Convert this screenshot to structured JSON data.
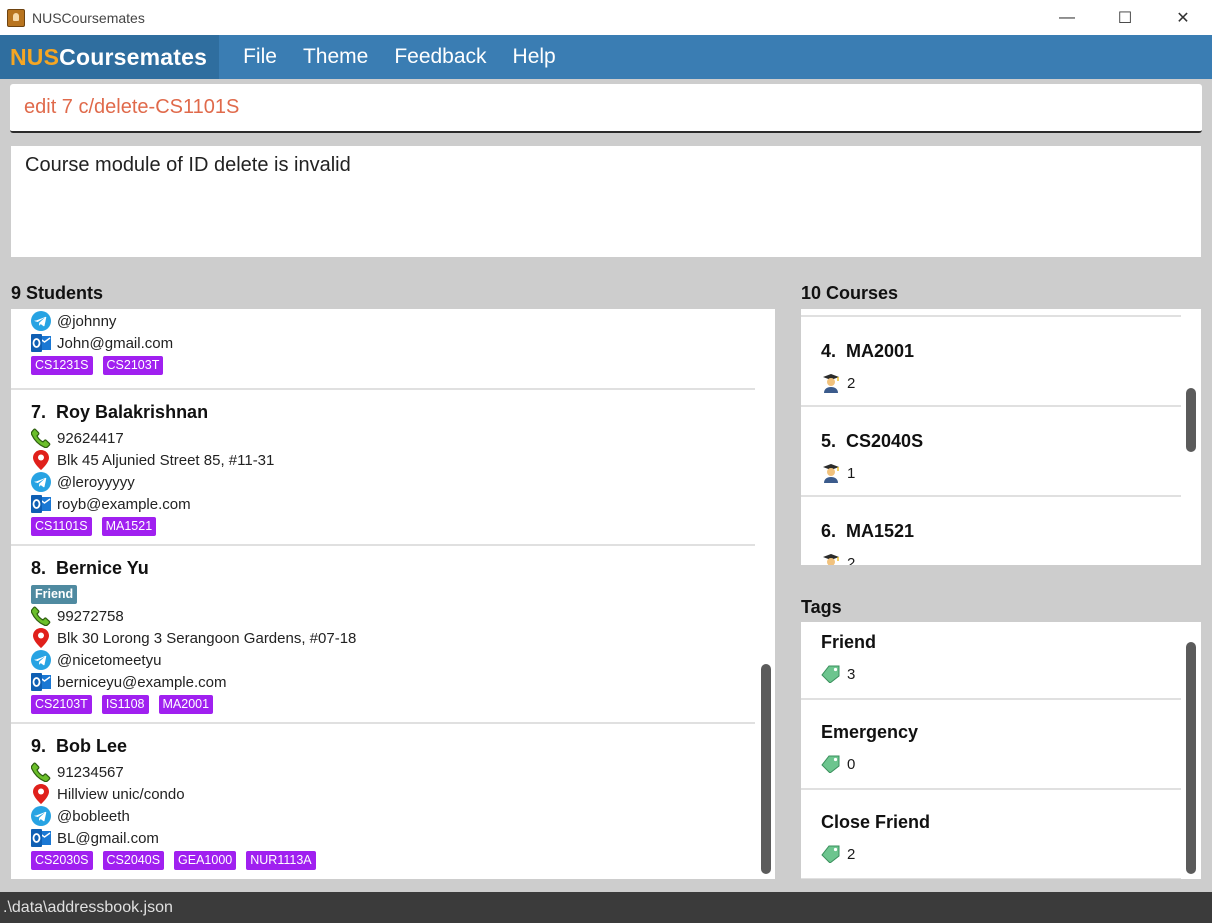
{
  "window": {
    "title": "NUSCoursemates",
    "minimize_glyph": "—",
    "maximize_glyph": "☐",
    "close_glyph": "✕"
  },
  "menubar": {
    "brand_prefix": "NUS",
    "brand_suffix": "Coursemates",
    "items": [
      "File",
      "Theme",
      "Feedback",
      "Help"
    ]
  },
  "command": {
    "value": "edit 7 c/delete-CS1101S"
  },
  "result": {
    "text": "Course module of ID delete is invalid"
  },
  "students": {
    "header": "9 Students",
    "cards": [
      {
        "index": "",
        "name": "",
        "tags": [],
        "phone": "",
        "address": "",
        "telegram": "@johnny",
        "email": "John@gmail.com",
        "courses": [
          "CS1231S",
          "CS2103T"
        ]
      },
      {
        "index": "7.",
        "name": "Roy Balakrishnan",
        "tags": [],
        "phone": "92624417",
        "address": "Blk 45 Aljunied Street 85, #11-31",
        "telegram": "@leroyyyyy",
        "email": "royb@example.com",
        "courses": [
          "CS1101S",
          "MA1521"
        ]
      },
      {
        "index": "8.",
        "name": "Bernice Yu",
        "tags": [
          "Friend"
        ],
        "phone": "99272758",
        "address": "Blk 30 Lorong 3 Serangoon Gardens, #07-18",
        "telegram": "@nicetomeetyu",
        "email": "berniceyu@example.com",
        "courses": [
          "CS2103T",
          "IS1108",
          "MA2001"
        ]
      },
      {
        "index": "9.",
        "name": "Bob Lee",
        "tags": [],
        "phone": "91234567",
        "address": "Hillview unic/condo",
        "telegram": "@bobleeth",
        "email": "BL@gmail.com",
        "courses": [
          "CS2030S",
          "CS2040S",
          "GEA1000",
          "NUR1113A"
        ]
      }
    ]
  },
  "courses": {
    "header": "10 Courses",
    "cards": [
      {
        "index": "4.",
        "code": "MA2001",
        "count": "2"
      },
      {
        "index": "5.",
        "code": "CS2040S",
        "count": "1"
      },
      {
        "index": "6.",
        "code": "MA1521",
        "count": "2"
      }
    ]
  },
  "tags": {
    "header": "Tags",
    "cards": [
      {
        "name": "Friend",
        "count": "3"
      },
      {
        "name": "Emergency",
        "count": "0"
      },
      {
        "name": "Close Friend",
        "count": "2"
      }
    ]
  },
  "status": {
    "path": ".\\data\\addressbook.json"
  },
  "colors": {
    "menubar": "#3a7db3",
    "brand_accent": "#f5a623",
    "command_text": "#e06a4b",
    "course_tag": "#a020f0",
    "friend_tag": "#4f8aa0"
  },
  "icons": {
    "phone": "phone-icon",
    "address": "location-pin-icon",
    "telegram": "telegram-icon",
    "email": "outlook-email-icon",
    "course_count": "student-icon",
    "tag_count": "tag-icon"
  }
}
